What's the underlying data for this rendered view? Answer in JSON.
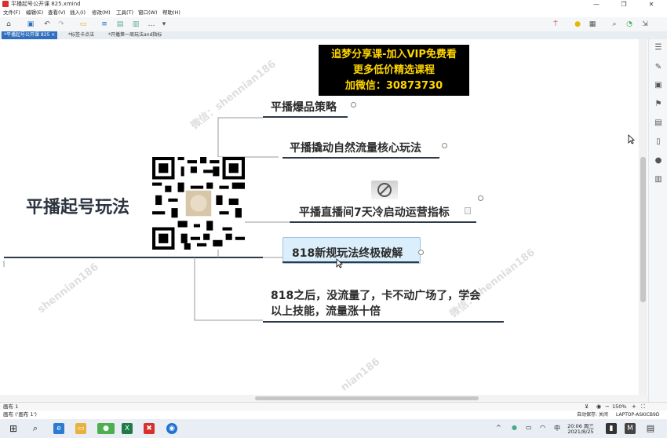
{
  "window": {
    "title": "平播起号公开课 825.xmind",
    "controls": [
      "—",
      "❐",
      "✕"
    ]
  },
  "menu": [
    "文件(F)",
    "编辑(E)",
    "查看(V)",
    "插入(I)",
    "修改(M)",
    "工具(T)",
    "窗口(W)",
    "帮助(H)"
  ],
  "tabs": [
    {
      "label": "*平播起号公开课 825",
      "close": "×",
      "active": true
    },
    {
      "label": "*标签卡点法",
      "close": "",
      "active": false
    },
    {
      "label": "*开播第一周玩法and指标",
      "close": "",
      "active": false
    }
  ],
  "banner": {
    "line1": "追梦分享课-加入VIP免费看",
    "line2": "更多低价精选课程",
    "line3": "加微信：30873730"
  },
  "mindmap": {
    "central": "平播起号玩法",
    "topics": [
      "平播爆品策略",
      "平播撬动自然流量核心玩法",
      "平播直播间7天冷启动运营指标",
      "818新规玩法终极破解",
      "818之后，没流量了，卡不动广场了，学会",
      "以上技能，流量涨十倍"
    ]
  },
  "watermarks": [
    "微信：shennian186",
    "shennian186",
    "微信：shennian186",
    "shennian186",
    "nian186"
  ],
  "sheet": {
    "label": "画布 1",
    "status": "画布 ('画布 1')",
    "zoom": "150%",
    "autosave": "自动保存: 关闭",
    "computer": "LAPTOP-ASKICB9D"
  },
  "taskbar": {
    "time": "20:06 周三",
    "date": "2021/8/25",
    "ime": "中"
  },
  "colors": {
    "accent": "#2f6fbe",
    "banner_text": "#ffd500",
    "topic_selected": "#dbeefb"
  }
}
